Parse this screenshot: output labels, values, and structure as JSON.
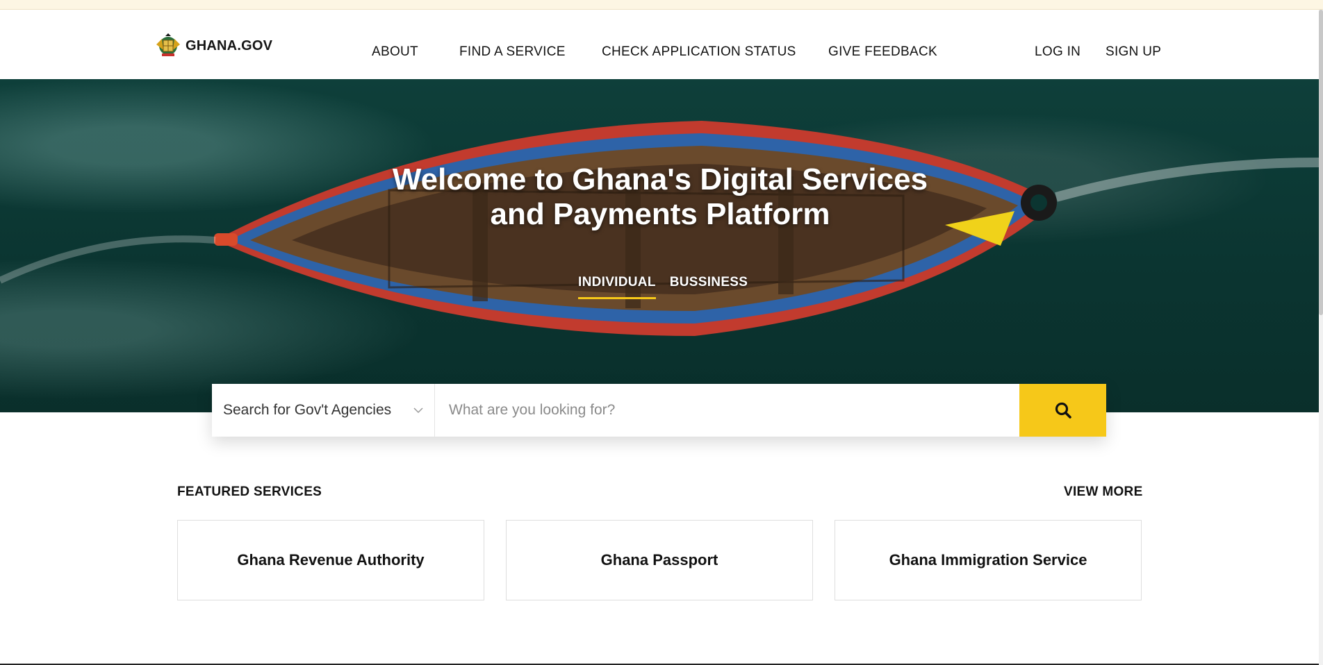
{
  "brand": {
    "logo_text": "GHANA.GOV"
  },
  "nav": {
    "items": [
      {
        "label": "ABOUT"
      },
      {
        "label": "FIND A SERVICE"
      },
      {
        "label": "CHECK APPLICATION STATUS"
      },
      {
        "label": "GIVE FEEDBACK"
      }
    ],
    "login": "LOG IN",
    "signup": "SIGN UP"
  },
  "hero": {
    "title_line1": "Welcome to Ghana's Digital Services",
    "title_line2": "and Payments Platform",
    "tabs": [
      {
        "label": "INDIVIDUAL",
        "active": true
      },
      {
        "label": "BUSSINESS",
        "active": false
      }
    ]
  },
  "search": {
    "agency_select": "Search for Gov't Agencies",
    "placeholder": "What are you looking for?"
  },
  "featured": {
    "title": "FEATURED SERVICES",
    "view_more": "VIEW MORE",
    "cards": [
      {
        "title": "Ghana Revenue Authority"
      },
      {
        "title": "Ghana Passport"
      },
      {
        "title": "Ghana Immigration Service"
      }
    ]
  },
  "colors": {
    "accent": "#f6c819",
    "hero_sea": "#0b3531"
  }
}
